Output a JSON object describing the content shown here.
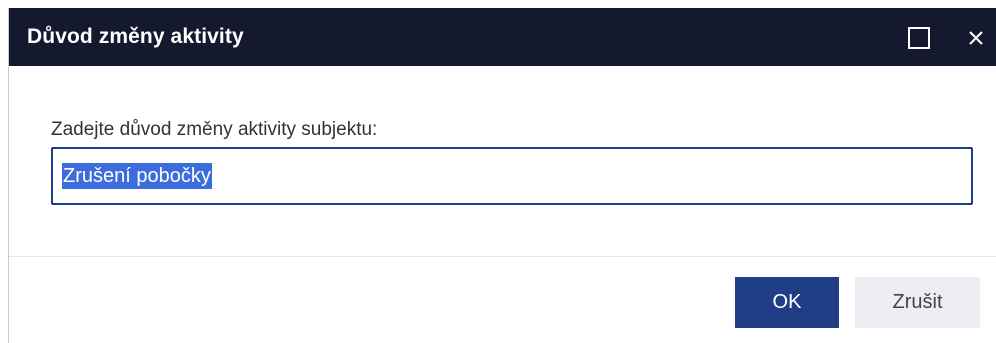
{
  "dialog": {
    "title": "Důvod změny aktivity",
    "prompt": "Zadejte důvod změny aktivity subjektu:",
    "input_value": "Zrušení pobočky",
    "ok_label": "OK",
    "cancel_label": "Zrušit",
    "icons": {
      "maximize": "maximize-icon",
      "close": "close-icon"
    }
  },
  "colors": {
    "titlebar": "#14192e",
    "primary_button": "#1f3e86",
    "secondary_button": "#eceef3",
    "selection": "#3b6edc"
  }
}
